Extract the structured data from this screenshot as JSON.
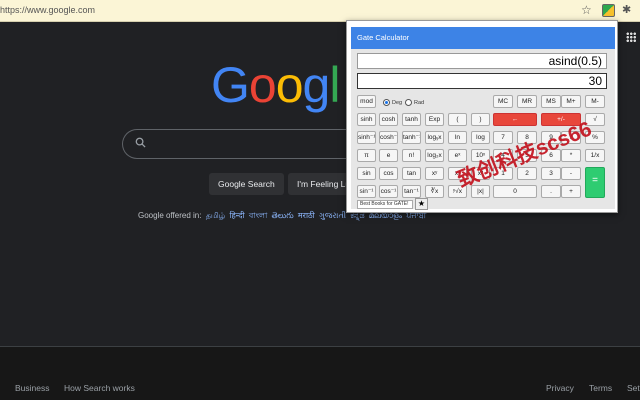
{
  "browser": {
    "url": "https://www.google.com",
    "star_glyph": "☆",
    "puzzle_glyph": "✱"
  },
  "google": {
    "logo_letters": [
      {
        "char": "G",
        "color": "#4285f4"
      },
      {
        "char": "o",
        "color": "#ea4335"
      },
      {
        "char": "o",
        "color": "#fbbc05"
      },
      {
        "char": "g",
        "color": "#4285f4"
      },
      {
        "char": "l",
        "color": "#34a853"
      }
    ],
    "search_button": "Google Search",
    "lucky_button": "I'm Feeling Lu",
    "offered_in": "Google offered in:",
    "languages": [
      "தமிழ்",
      "हिन्दी",
      "বাংলা",
      "తెలుగు",
      "मराठी",
      "ગુજરાતી",
      "ಕನ್ನಡ",
      "മലയാളം",
      "ਪੰਜਾਬੀ"
    ],
    "footer": {
      "business": "Business",
      "how_search": "How Search works",
      "privacy": "Privacy",
      "terms": "Terms",
      "settings": "Setti"
    }
  },
  "calculator": {
    "title": "Gate Calculator",
    "expression": "asind(0.5)",
    "result": "30",
    "deg_label": "Deg",
    "rad_label": "Rad",
    "books_label": "Best Books for GATE!",
    "fav_glyph": "★",
    "watermark": "致创科技scs66",
    "accent_color": "#3d83e6",
    "keys": {
      "mod": "mod",
      "mc": "MC",
      "mr": "MR",
      "ms": "MS",
      "mplus": "M+",
      "mminus": "M-",
      "sinh": "sinh",
      "cosh": "cosh",
      "tanh": "tanh",
      "exp": "Exp",
      "lparen": "(",
      "rparen": ")",
      "backspace": "←",
      "plusminus": "+/-",
      "sqrt": "√",
      "asinh": "sinh⁻¹",
      "acosh": "cosh⁻¹",
      "atanh": "tanh⁻¹",
      "logyx": "logᵧx",
      "ln": "ln",
      "log": "log",
      "k7": "7",
      "k8": "8",
      "k9": "9",
      "div": "/",
      "pct": "%",
      "pi": "π",
      "e": "e",
      "fact": "n!",
      "log2x": "log₂x",
      "ex": "eˣ",
      "tenx": "10ˣ",
      "k4": "4",
      "k5": "5",
      "k6": "6",
      "mul": "*",
      "recip": "1/x",
      "sin": "sin",
      "cos": "cos",
      "tan": "tan",
      "xy": "xʸ",
      "x3": "x³",
      "x2": "x²",
      "k1": "1",
      "k2": "2",
      "k3": "3",
      "sub": "-",
      "eq": "=",
      "asin": "sin⁻¹",
      "acos": "cos⁻¹",
      "atan": "tan⁻¹",
      "cbrt": "∛x",
      "yroot": "ʸ√x",
      "absx": "|x|",
      "k0": "0",
      "dot": ".",
      "add": "+"
    }
  }
}
